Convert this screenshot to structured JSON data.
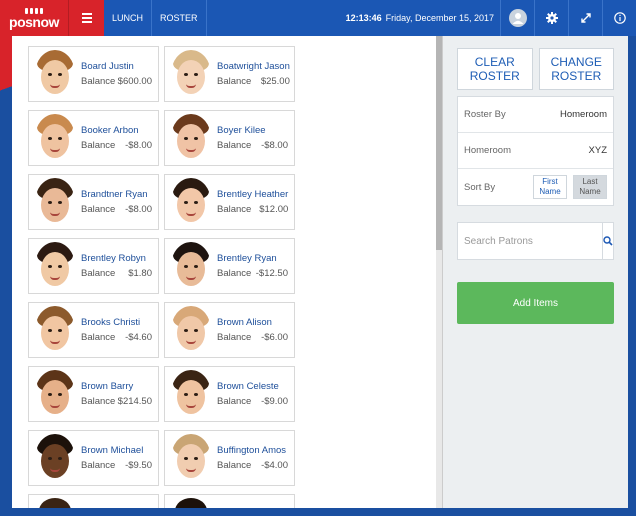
{
  "app": {
    "logo_text": "posnow"
  },
  "nav": {
    "items": [
      {
        "label": "LUNCH"
      },
      {
        "label": "ROSTER"
      }
    ],
    "time": "12:13:46",
    "date": "Friday, December 15, 2017"
  },
  "patrons": [
    {
      "name": "Board Justin",
      "balance_label": "Balance",
      "balance": "$600.00",
      "skin": "#f0c9a4",
      "hair": "#a86b34"
    },
    {
      "name": "Boatwright Jason",
      "balance_label": "Balance",
      "balance": "$25.00",
      "skin": "#f3d2b6",
      "hair": "#d9b98a"
    },
    {
      "name": "Booker Arbon",
      "balance_label": "Balance",
      "balance": "-$8.00",
      "skin": "#efc3a0",
      "hair": "#c98a4e"
    },
    {
      "name": "Boyer Kilee",
      "balance_label": "Balance",
      "balance": "-$8.00",
      "skin": "#f0c3a5",
      "hair": "#6b3a1c"
    },
    {
      "name": "Brandtner Ryan",
      "balance_label": "Balance",
      "balance": "-$8.00",
      "skin": "#e9b997",
      "hair": "#3a2414"
    },
    {
      "name": "Brentley Heather",
      "balance_label": "Balance",
      "balance": "$12.00",
      "skin": "#f2c7a8",
      "hair": "#2a1a10"
    },
    {
      "name": "Brentley Robyn",
      "balance_label": "Balance",
      "balance": "$1.80",
      "skin": "#f0c9a4",
      "hair": "#2c1a12"
    },
    {
      "name": "Brentley Ryan",
      "balance_label": "Balance",
      "balance": "-$12.50",
      "skin": "#e8bb98",
      "hair": "#1e1410"
    },
    {
      "name": "Brooks Christi",
      "balance_label": "Balance",
      "balance": "-$4.60",
      "skin": "#f1c6a2",
      "hair": "#8c5a2c"
    },
    {
      "name": "Brown Alison",
      "balance_label": "Balance",
      "balance": "-$6.00",
      "skin": "#f0c8a8",
      "hair": "#d8a878"
    },
    {
      "name": "Brown Barry",
      "balance_label": "Balance",
      "balance": "$214.50",
      "skin": "#e6b089",
      "hair": "#5c3418"
    },
    {
      "name": "Brown Celeste",
      "balance_label": "Balance",
      "balance": "-$9.00",
      "skin": "#efc3a0",
      "hair": "#3a2414"
    },
    {
      "name": "Brown Michael",
      "balance_label": "Balance",
      "balance": "-$9.50",
      "skin": "#6b4024",
      "hair": "#1c110a"
    },
    {
      "name": "Buffington Amos",
      "balance_label": "Balance",
      "balance": "-$4.00",
      "skin": "#f1cdb0",
      "hair": "#c9a574"
    }
  ],
  "sidebar": {
    "clear_roster": "CLEAR ROSTER",
    "change_roster": "CHANGE ROSTER",
    "roster_by_label": "Roster By",
    "roster_by_value": "Homeroom",
    "homeroom_label": "Homeroom",
    "homeroom_value": "XYZ",
    "sort_by_label": "Sort By",
    "sort_first": "First Name",
    "sort_last": "Last Name",
    "search_placeholder": "Search Patrons",
    "add_items": "Add Items"
  }
}
